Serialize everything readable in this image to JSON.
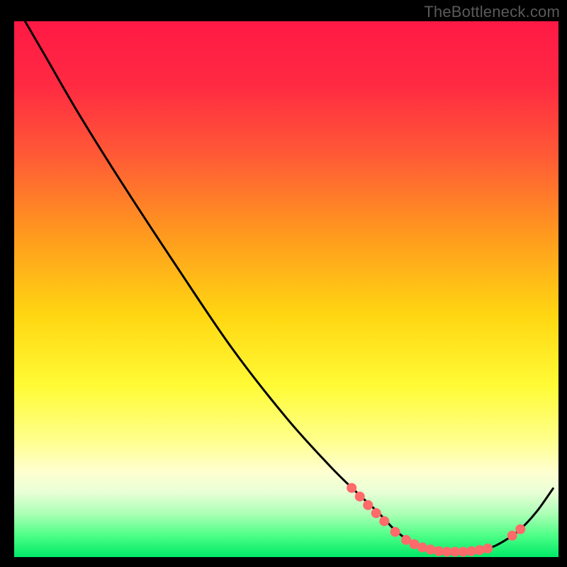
{
  "watermark": "TheBottleneck.com",
  "chart_data": {
    "type": "line",
    "title": "",
    "xlabel": "",
    "ylabel": "",
    "xlim": [
      0,
      100
    ],
    "ylim": [
      0,
      100
    ],
    "gradient_stops": [
      {
        "offset": 0,
        "color": "#ff1945"
      },
      {
        "offset": 12,
        "color": "#ff2a42"
      },
      {
        "offset": 25,
        "color": "#ff5a36"
      },
      {
        "offset": 40,
        "color": "#ff9a1e"
      },
      {
        "offset": 55,
        "color": "#ffd712"
      },
      {
        "offset": 68,
        "color": "#fffb35"
      },
      {
        "offset": 78,
        "color": "#ffff8a"
      },
      {
        "offset": 84,
        "color": "#ffffd0"
      },
      {
        "offset": 88,
        "color": "#e8ffd6"
      },
      {
        "offset": 92,
        "color": "#aaffb4"
      },
      {
        "offset": 96,
        "color": "#4dff87"
      },
      {
        "offset": 100,
        "color": "#00e867"
      }
    ],
    "series": [
      {
        "name": "curve",
        "points": [
          {
            "x": 2.0,
            "y": 100.0
          },
          {
            "x": 6.0,
            "y": 93.0
          },
          {
            "x": 12.0,
            "y": 82.5
          },
          {
            "x": 20.0,
            "y": 69.5
          },
          {
            "x": 30.0,
            "y": 54.0
          },
          {
            "x": 40.0,
            "y": 39.0
          },
          {
            "x": 50.0,
            "y": 26.0
          },
          {
            "x": 58.0,
            "y": 17.0
          },
          {
            "x": 63.0,
            "y": 12.0
          },
          {
            "x": 67.0,
            "y": 8.2
          },
          {
            "x": 70.0,
            "y": 5.0
          },
          {
            "x": 73.0,
            "y": 2.8
          },
          {
            "x": 76.0,
            "y": 1.6
          },
          {
            "x": 79.0,
            "y": 1.1
          },
          {
            "x": 83.0,
            "y": 1.1
          },
          {
            "x": 87.0,
            "y": 1.6
          },
          {
            "x": 90.0,
            "y": 3.0
          },
          {
            "x": 93.0,
            "y": 5.2
          },
          {
            "x": 96.0,
            "y": 8.5
          },
          {
            "x": 99.0,
            "y": 12.8
          }
        ]
      }
    ],
    "markers": [
      {
        "x": 62.0,
        "y": 12.9
      },
      {
        "x": 63.5,
        "y": 11.3
      },
      {
        "x": 65.0,
        "y": 9.7
      },
      {
        "x": 66.5,
        "y": 8.2
      },
      {
        "x": 68.0,
        "y": 6.7
      },
      {
        "x": 70.0,
        "y": 4.7
      },
      {
        "x": 72.0,
        "y": 3.2
      },
      {
        "x": 73.5,
        "y": 2.4
      },
      {
        "x": 75.0,
        "y": 1.8
      },
      {
        "x": 76.5,
        "y": 1.4
      },
      {
        "x": 78.0,
        "y": 1.1
      },
      {
        "x": 79.5,
        "y": 1.0
      },
      {
        "x": 81.0,
        "y": 1.0
      },
      {
        "x": 82.5,
        "y": 1.0
      },
      {
        "x": 84.0,
        "y": 1.1
      },
      {
        "x": 85.5,
        "y": 1.3
      },
      {
        "x": 87.0,
        "y": 1.6
      },
      {
        "x": 91.5,
        "y": 4.0
      },
      {
        "x": 93.0,
        "y": 5.2
      }
    ],
    "marker_color": "#ff6a6a",
    "marker_radius": 7
  }
}
